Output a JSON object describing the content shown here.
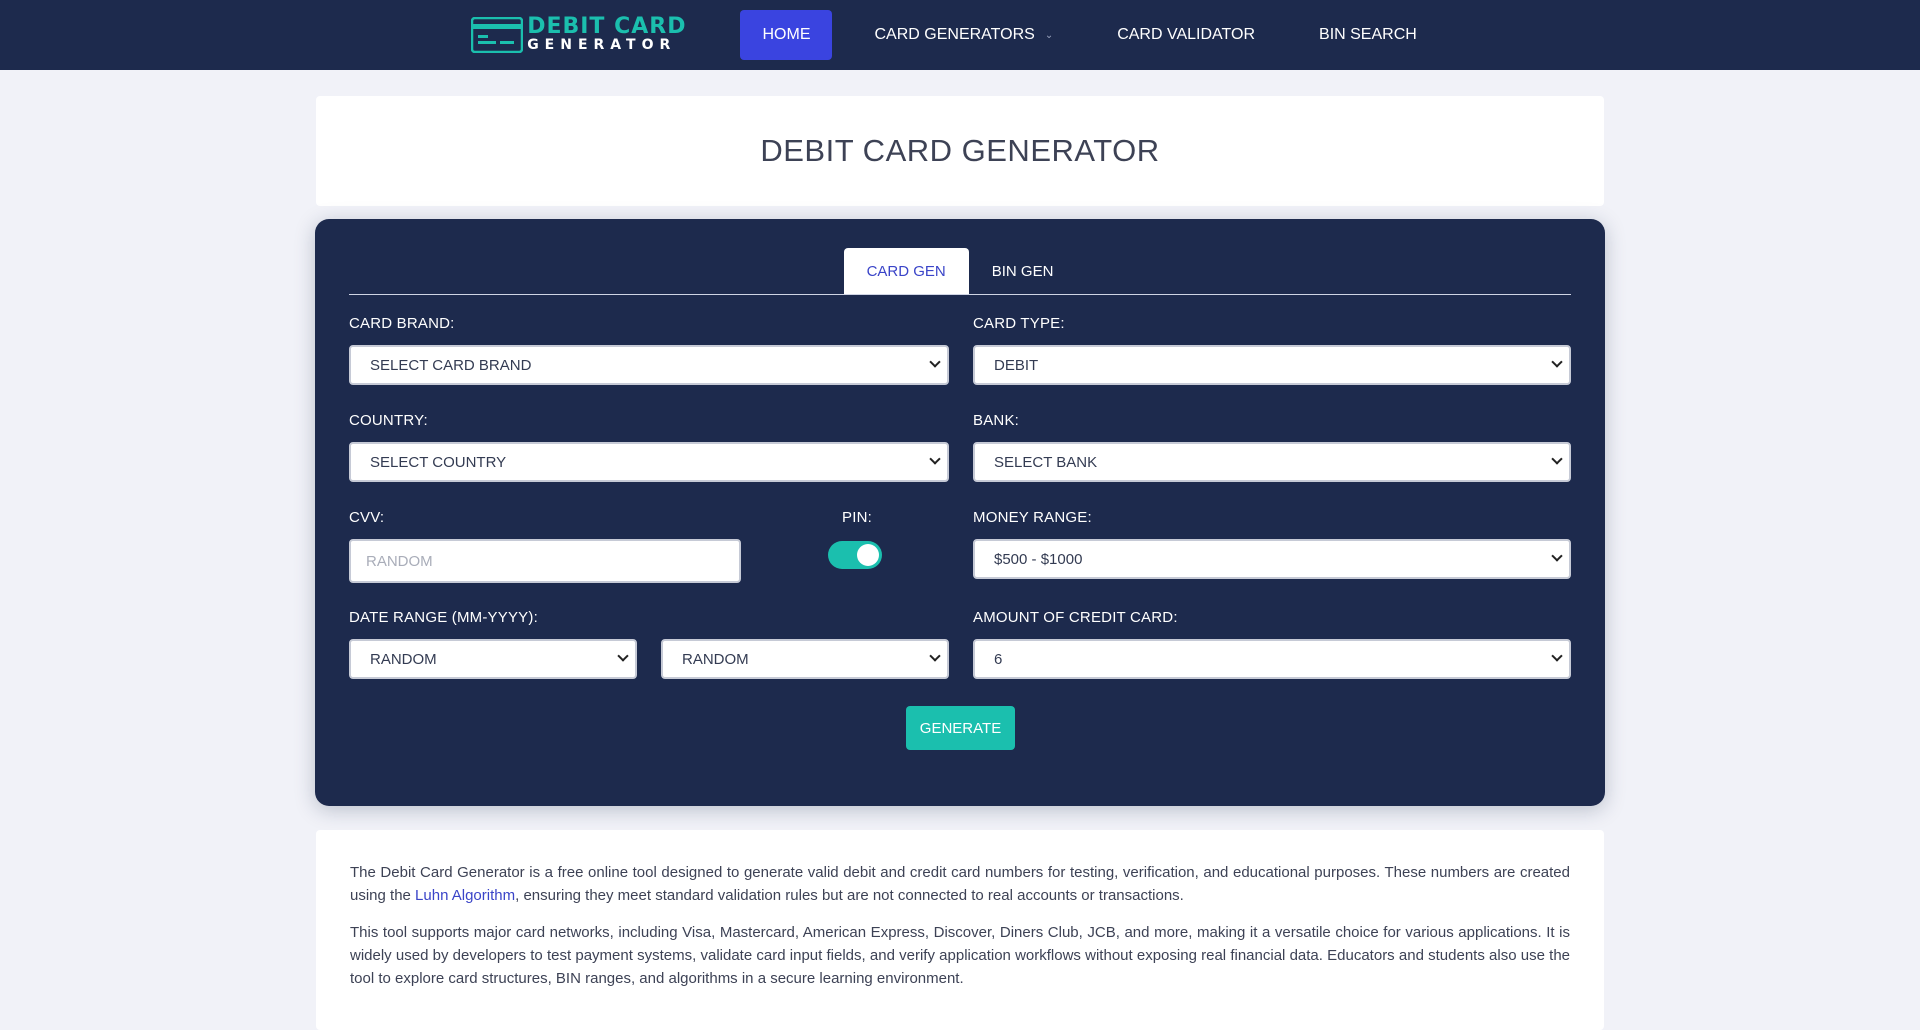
{
  "nav": {
    "logo_top": "DEBIT CARD",
    "logo_bottom": "GENERATOR",
    "items": [
      {
        "label": "HOME"
      },
      {
        "label": "CARD GENERATORS"
      },
      {
        "label": "CARD VALIDATOR"
      },
      {
        "label": "BIN SEARCH"
      }
    ],
    "chevron": "chevron-down-icon"
  },
  "page_title": "DEBIT CARD GENERATOR",
  "tabs": [
    {
      "label": "CARD GEN"
    },
    {
      "label": "BIN GEN"
    }
  ],
  "form": {
    "card_brand_label": "CARD BRAND:",
    "card_brand_value": "SELECT CARD BRAND",
    "card_type_label": "CARD TYPE:",
    "card_type_value": "DEBIT",
    "country_label": "COUNTRY:",
    "country_value": "SELECT COUNTRY",
    "bank_label": "BANK:",
    "bank_value": "SELECT BANK",
    "cvv_label": "CVV:",
    "cvv_placeholder": "RANDOM",
    "pin_label": "PIN:",
    "pin_enabled": true,
    "money_range_label": "MONEY RANGE:",
    "money_range_value": "$500 - $1000",
    "date_range_label": "DATE RANGE (MM-YYYY):",
    "date_from_value": "RANDOM",
    "date_to_value": "RANDOM",
    "amount_label": "AMOUNT OF CREDIT CARD:",
    "amount_value": "6",
    "generate_label": "GENERATE"
  },
  "description": {
    "p1_before": "The Debit Card Generator is a free online tool designed to generate valid debit and credit card numbers for testing, verification, and educational purposes. These numbers are created using the ",
    "p1_link": "Luhn Algorithm",
    "p1_after": ", ensuring they meet standard validation rules but are not connected to real accounts or transactions.",
    "p2": "This tool supports major card networks, including Visa, Mastercard, American Express, Discover, Diners Club, JCB, and more, making it a versatile choice for various applications. It is widely used by developers to test payment systems, validate card input fields, and verify application workflows without exposing real financial data. Educators and students also use the tool to explore card structures, BIN ranges, and algorithms in a secure learning environment."
  },
  "colors": {
    "navy": "#1d2a4d",
    "accent_blue": "#3a44e0",
    "teal": "#1bbfae"
  }
}
